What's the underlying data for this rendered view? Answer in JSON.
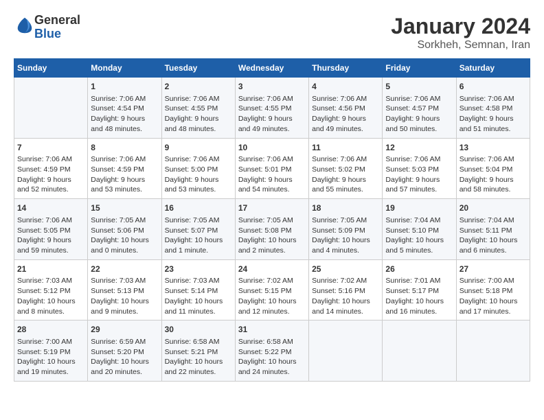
{
  "header": {
    "logo_general": "General",
    "logo_blue": "Blue",
    "title": "January 2024",
    "subtitle": "Sorkheh, Semnan, Iran"
  },
  "columns": [
    "Sunday",
    "Monday",
    "Tuesday",
    "Wednesday",
    "Thursday",
    "Friday",
    "Saturday"
  ],
  "weeks": [
    [
      {
        "day": "",
        "info": ""
      },
      {
        "day": "1",
        "info": "Sunrise: 7:06 AM\nSunset: 4:54 PM\nDaylight: 9 hours\nand 48 minutes."
      },
      {
        "day": "2",
        "info": "Sunrise: 7:06 AM\nSunset: 4:55 PM\nDaylight: 9 hours\nand 48 minutes."
      },
      {
        "day": "3",
        "info": "Sunrise: 7:06 AM\nSunset: 4:55 PM\nDaylight: 9 hours\nand 49 minutes."
      },
      {
        "day": "4",
        "info": "Sunrise: 7:06 AM\nSunset: 4:56 PM\nDaylight: 9 hours\nand 49 minutes."
      },
      {
        "day": "5",
        "info": "Sunrise: 7:06 AM\nSunset: 4:57 PM\nDaylight: 9 hours\nand 50 minutes."
      },
      {
        "day": "6",
        "info": "Sunrise: 7:06 AM\nSunset: 4:58 PM\nDaylight: 9 hours\nand 51 minutes."
      }
    ],
    [
      {
        "day": "7",
        "info": "Sunrise: 7:06 AM\nSunset: 4:59 PM\nDaylight: 9 hours\nand 52 minutes."
      },
      {
        "day": "8",
        "info": "Sunrise: 7:06 AM\nSunset: 4:59 PM\nDaylight: 9 hours\nand 53 minutes."
      },
      {
        "day": "9",
        "info": "Sunrise: 7:06 AM\nSunset: 5:00 PM\nDaylight: 9 hours\nand 53 minutes."
      },
      {
        "day": "10",
        "info": "Sunrise: 7:06 AM\nSunset: 5:01 PM\nDaylight: 9 hours\nand 54 minutes."
      },
      {
        "day": "11",
        "info": "Sunrise: 7:06 AM\nSunset: 5:02 PM\nDaylight: 9 hours\nand 55 minutes."
      },
      {
        "day": "12",
        "info": "Sunrise: 7:06 AM\nSunset: 5:03 PM\nDaylight: 9 hours\nand 57 minutes."
      },
      {
        "day": "13",
        "info": "Sunrise: 7:06 AM\nSunset: 5:04 PM\nDaylight: 9 hours\nand 58 minutes."
      }
    ],
    [
      {
        "day": "14",
        "info": "Sunrise: 7:06 AM\nSunset: 5:05 PM\nDaylight: 9 hours\nand 59 minutes."
      },
      {
        "day": "15",
        "info": "Sunrise: 7:05 AM\nSunset: 5:06 PM\nDaylight: 10 hours\nand 0 minutes."
      },
      {
        "day": "16",
        "info": "Sunrise: 7:05 AM\nSunset: 5:07 PM\nDaylight: 10 hours\nand 1 minute."
      },
      {
        "day": "17",
        "info": "Sunrise: 7:05 AM\nSunset: 5:08 PM\nDaylight: 10 hours\nand 2 minutes."
      },
      {
        "day": "18",
        "info": "Sunrise: 7:05 AM\nSunset: 5:09 PM\nDaylight: 10 hours\nand 4 minutes."
      },
      {
        "day": "19",
        "info": "Sunrise: 7:04 AM\nSunset: 5:10 PM\nDaylight: 10 hours\nand 5 minutes."
      },
      {
        "day": "20",
        "info": "Sunrise: 7:04 AM\nSunset: 5:11 PM\nDaylight: 10 hours\nand 6 minutes."
      }
    ],
    [
      {
        "day": "21",
        "info": "Sunrise: 7:03 AM\nSunset: 5:12 PM\nDaylight: 10 hours\nand 8 minutes."
      },
      {
        "day": "22",
        "info": "Sunrise: 7:03 AM\nSunset: 5:13 PM\nDaylight: 10 hours\nand 9 minutes."
      },
      {
        "day": "23",
        "info": "Sunrise: 7:03 AM\nSunset: 5:14 PM\nDaylight: 10 hours\nand 11 minutes."
      },
      {
        "day": "24",
        "info": "Sunrise: 7:02 AM\nSunset: 5:15 PM\nDaylight: 10 hours\nand 12 minutes."
      },
      {
        "day": "25",
        "info": "Sunrise: 7:02 AM\nSunset: 5:16 PM\nDaylight: 10 hours\nand 14 minutes."
      },
      {
        "day": "26",
        "info": "Sunrise: 7:01 AM\nSunset: 5:17 PM\nDaylight: 10 hours\nand 16 minutes."
      },
      {
        "day": "27",
        "info": "Sunrise: 7:00 AM\nSunset: 5:18 PM\nDaylight: 10 hours\nand 17 minutes."
      }
    ],
    [
      {
        "day": "28",
        "info": "Sunrise: 7:00 AM\nSunset: 5:19 PM\nDaylight: 10 hours\nand 19 minutes."
      },
      {
        "day": "29",
        "info": "Sunrise: 6:59 AM\nSunset: 5:20 PM\nDaylight: 10 hours\nand 20 minutes."
      },
      {
        "day": "30",
        "info": "Sunrise: 6:58 AM\nSunset: 5:21 PM\nDaylight: 10 hours\nand 22 minutes."
      },
      {
        "day": "31",
        "info": "Sunrise: 6:58 AM\nSunset: 5:22 PM\nDaylight: 10 hours\nand 24 minutes."
      },
      {
        "day": "",
        "info": ""
      },
      {
        "day": "",
        "info": ""
      },
      {
        "day": "",
        "info": ""
      }
    ]
  ]
}
